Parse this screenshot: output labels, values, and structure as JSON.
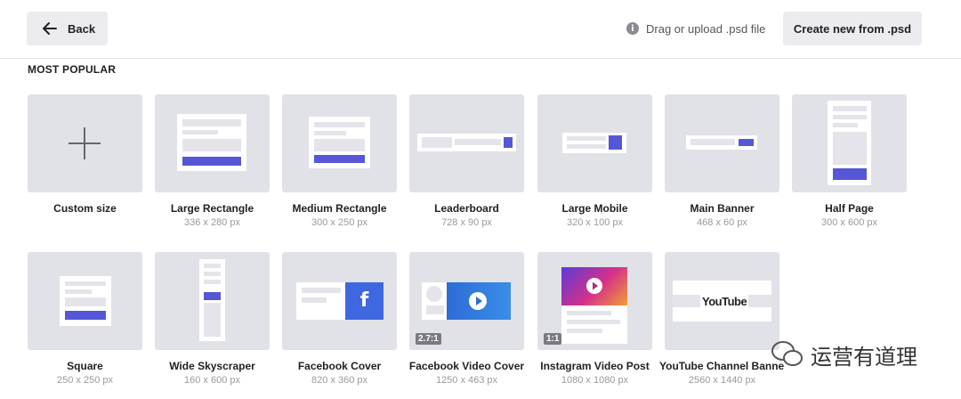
{
  "header": {
    "back_label": "Back",
    "upload_text": "Drag or upload .psd file",
    "create_label": "Create new from .psd"
  },
  "section_title": "MOST POPULAR",
  "cards": [
    {
      "name": "Custom size",
      "size": ""
    },
    {
      "name": "Large Rectangle",
      "size": "336 x 280 px"
    },
    {
      "name": "Medium Rectangle",
      "size": "300 x 250 px"
    },
    {
      "name": "Leaderboard",
      "size": "728 x 90 px"
    },
    {
      "name": "Large Mobile",
      "size": "320 x 100 px"
    },
    {
      "name": "Main Banner",
      "size": "468 x 60 px"
    },
    {
      "name": "Half Page",
      "size": "300 x 600 px"
    },
    {
      "name": "Square",
      "size": "250 x 250 px"
    },
    {
      "name": "Wide Skyscraper",
      "size": "160 x 600 px"
    },
    {
      "name": "Facebook Cover",
      "size": "820 x 360 px"
    },
    {
      "name": "Facebook Video Cover",
      "size": "1250 x 463 px",
      "ratio": "2.7:1"
    },
    {
      "name": "Instagram Video Post",
      "size": "1080 x 1080 px",
      "ratio": "1:1"
    },
    {
      "name": "YouTube Channel Banner",
      "size": "2560 x 1440 px",
      "logo_text": "YouTube"
    }
  ],
  "watermark": "运营有道理",
  "colors": {
    "accent": "#5557d6",
    "thumb_bg": "#e1e1e8",
    "button_bg": "#ececf0"
  }
}
